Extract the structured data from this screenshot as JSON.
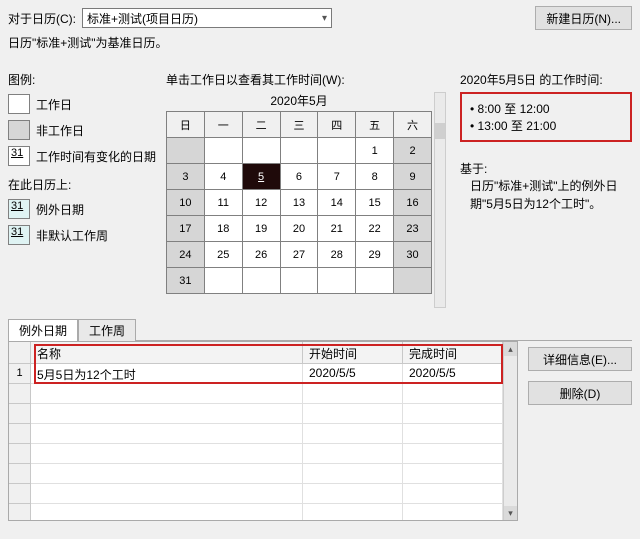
{
  "header": {
    "for_calendar_label": "对于日历(C):",
    "calendar_selected": "标准+测试(项目日历)",
    "new_calendar_button": "新建日历(N)...",
    "base_calendar_line": "日历\"标准+测试\"为基准日历。"
  },
  "legend": {
    "title": "图例:",
    "workday": "工作日",
    "nonworkday": "非工作日",
    "changed_hours": "工作时间有变化的日期",
    "changed_hours_num": "31",
    "on_this_calendar": "在此日历上:",
    "exception_date": "例外日期",
    "exception_num": "31",
    "nondefault_workweek": "非默认工作周",
    "nondefault_num": "31"
  },
  "calendar": {
    "click_label": "单击工作日以查看其工作时间(W):",
    "month_title": "2020年5月",
    "dow": [
      "日",
      "一",
      "二",
      "三",
      "四",
      "五",
      "六"
    ],
    "weeks": [
      [
        "",
        "",
        "",
        "",
        "",
        "1",
        "2"
      ],
      [
        "3",
        "4",
        "5",
        "6",
        "7",
        "8",
        "9"
      ],
      [
        "10",
        "11",
        "12",
        "13",
        "14",
        "15",
        "16"
      ],
      [
        "17",
        "18",
        "19",
        "20",
        "21",
        "22",
        "23"
      ],
      [
        "24",
        "25",
        "26",
        "27",
        "28",
        "29",
        "30"
      ],
      [
        "31",
        "",
        "",
        "",
        "",
        "",
        ""
      ]
    ],
    "selected_day": "5"
  },
  "hours": {
    "title": "2020年5月5日 的工作时间:",
    "items": [
      "8:00 至 12:00",
      "13:00 至 21:00"
    ]
  },
  "based_on": {
    "label": "基于:",
    "text": "日历\"标准+测试\"上的例外日期\"5月5日为12个工时\"。"
  },
  "tabs": {
    "exceptions": "例外日期",
    "workweeks": "工作周"
  },
  "grid": {
    "col_name": "名称",
    "col_start": "开始时间",
    "col_end": "完成时间",
    "rows": [
      {
        "num": "1",
        "name": "5月5日为12个工时",
        "start": "2020/5/5",
        "end": "2020/5/5"
      }
    ]
  },
  "side_buttons": {
    "details": "详细信息(E)...",
    "delete": "删除(D)"
  }
}
